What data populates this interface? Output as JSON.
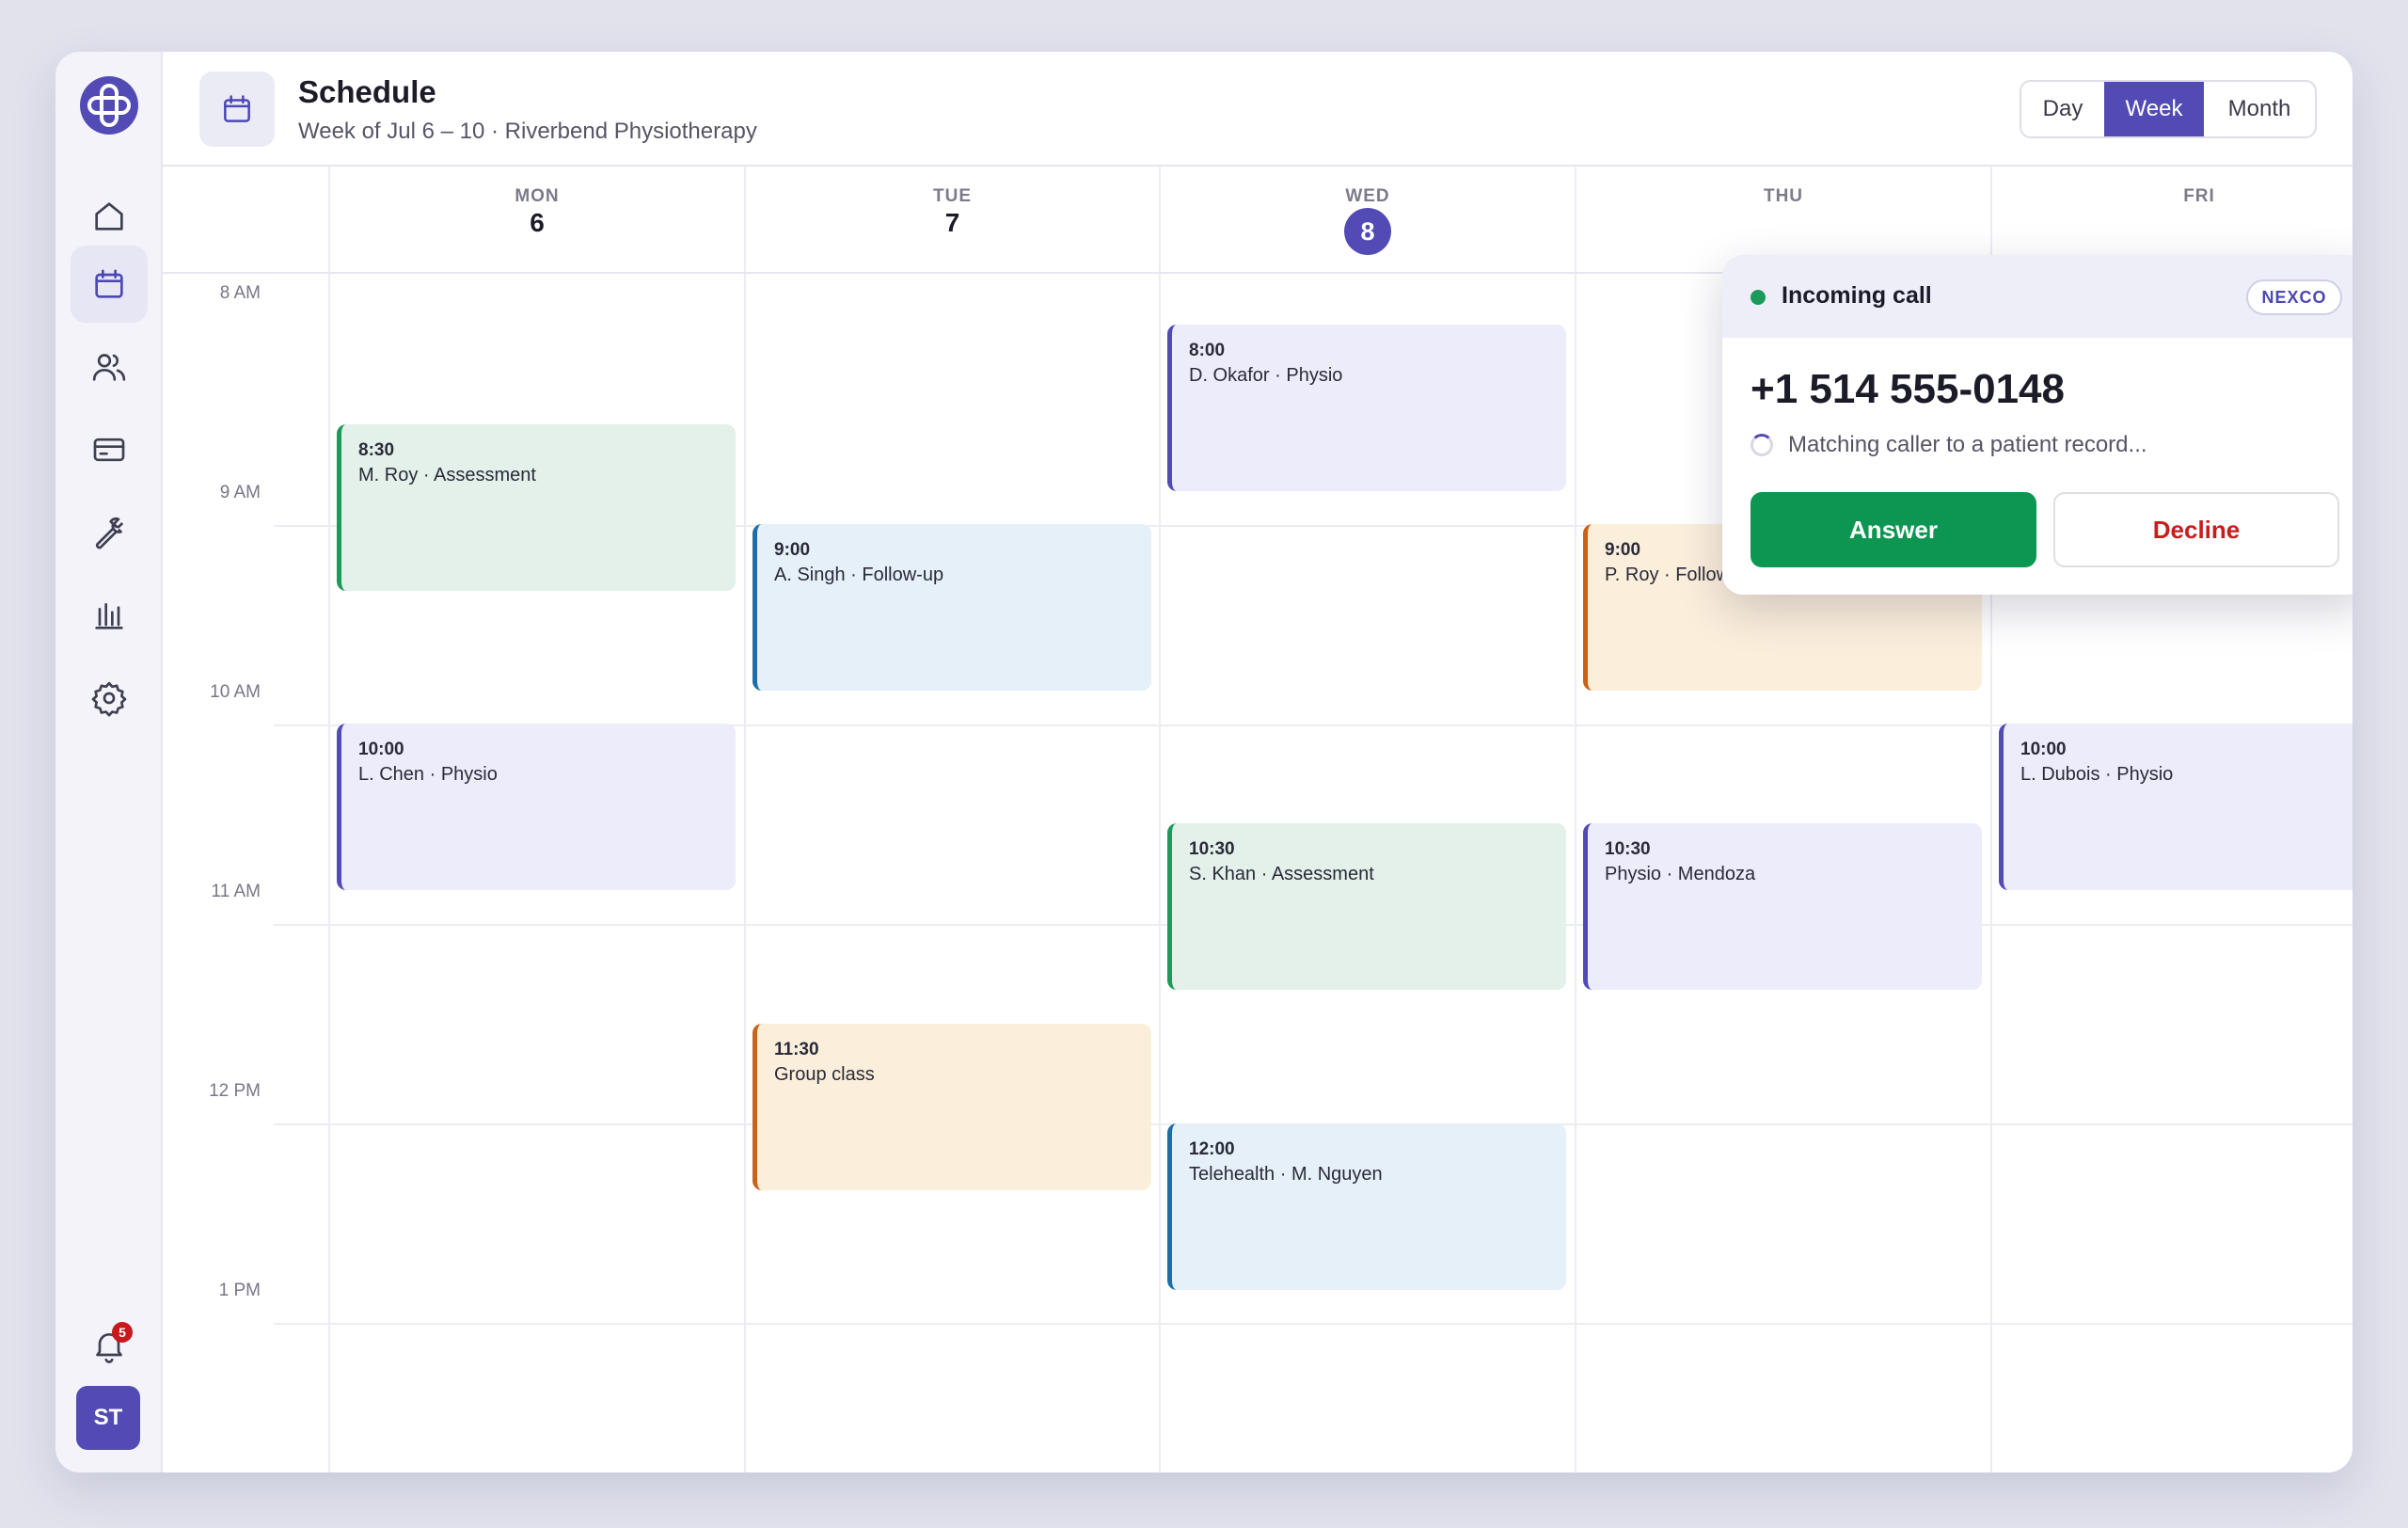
{
  "header": {
    "title": "Schedule",
    "subtitle": "Week of Jul 6 – 10 · Riverbend Physiotherapy",
    "views": {
      "day": "Day",
      "week": "Week",
      "month": "Month",
      "active": "Week"
    }
  },
  "sidebar": {
    "nav": [
      {
        "icon": "home-icon",
        "active": false
      },
      {
        "icon": "calendar-icon",
        "active": true
      },
      {
        "icon": "users-icon",
        "active": false
      },
      {
        "icon": "credit-card-icon",
        "active": false
      },
      {
        "icon": "wrench-icon",
        "active": false
      },
      {
        "icon": "bar-chart-icon",
        "active": false
      },
      {
        "icon": "gear-icon",
        "active": false
      }
    ],
    "notifications_count": "5",
    "avatar_initials": "ST"
  },
  "days": [
    {
      "name": "MON",
      "num": "6"
    },
    {
      "name": "TUE",
      "num": "7"
    },
    {
      "name": "WED",
      "num": "8",
      "today": true
    },
    {
      "name": "THU",
      "num": ""
    },
    {
      "name": "FRI",
      "num": ""
    }
  ],
  "hours": [
    "8 AM",
    "9 AM",
    "10 AM",
    "11 AM",
    "12 PM",
    "1 PM"
  ],
  "events": {
    "mon_1": {
      "time": "8:30",
      "title": "M. Roy · Assessment",
      "color": "#1b9a5c"
    },
    "mon_2": {
      "time": "10:00",
      "title": "L. Chen · Physio",
      "color": "#524bb5"
    },
    "tue_1": {
      "time": "9:00",
      "title": "A. Singh · Follow-up",
      "color": "#1d6da8"
    },
    "tue_2": {
      "time": "11:30",
      "title": "Group class",
      "color": "#cc6116"
    },
    "wed_1": {
      "time": "8:00",
      "title": "D. Okafor · Physio",
      "color": "#524bb5"
    },
    "wed_2": {
      "time": "10:30",
      "title": "S. Khan · Assessment",
      "color": "#1b9a5c"
    },
    "wed_3": {
      "time": "12:00",
      "title": "Telehealth · M. Nguyen",
      "color": "#1d6da8"
    },
    "thu_1": {
      "time": "9:00",
      "title": "P. Roy · Follow",
      "color": "#cc6116"
    },
    "thu_2": {
      "time": "10:30",
      "title": "Physio · Mendoza",
      "color": "#524bb5"
    },
    "fri_1": {
      "time": "10:00",
      "title": "L. Dubois · Physio",
      "color": "#524bb5"
    }
  },
  "incoming_call": {
    "label": "Incoming call",
    "badge": "NEXCO",
    "number": "+1 514 555-0148",
    "status": "Matching caller to a patient record...",
    "answer": "Answer",
    "decline": "Decline",
    "accent": "#0d9651"
  }
}
